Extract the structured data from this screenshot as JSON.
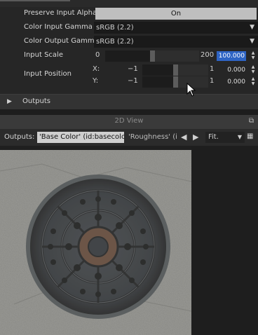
{
  "properties": {
    "preserve_alpha": {
      "label": "Preserve Input Alpha",
      "value": "On"
    },
    "color_input_gamma": {
      "label": "Color Input Gamma",
      "value": "sRGB (2.2)"
    },
    "color_output_gamma": {
      "label": "Color Output Gamma",
      "value": "sRGB (2.2)"
    },
    "input_scale": {
      "label": "Input Scale",
      "min": "0",
      "max": "200",
      "value": "100.000",
      "fraction": 0.5
    },
    "input_position": {
      "label": "Input Position",
      "x": {
        "axis": "X:",
        "min": "−1",
        "max": "1",
        "value": "0.000",
        "fraction": 0.5
      },
      "y": {
        "axis": "Y:",
        "min": "−1",
        "max": "1",
        "value": "0.000",
        "fraction": 0.5
      }
    },
    "select_arrow": "▼"
  },
  "outputs_section": {
    "label": "Outputs"
  },
  "view": {
    "title": "2D View",
    "outputs_label": "Outputs:",
    "active_output": "'Base Color' (id:basecolor)",
    "other_output": "'Roughness' (id",
    "zoom_mode": "Fit."
  },
  "colors": {
    "accent_selection": "#2e64c4",
    "toggle_bg": "#bfbfbf",
    "panel_bg": "#262626"
  },
  "icons": [
    "expand-arrow-icon",
    "popout-icon",
    "prev-icon",
    "next-icon",
    "dropdown-arrow-icon",
    "settings-icon",
    "mouse-cursor-icon"
  ]
}
